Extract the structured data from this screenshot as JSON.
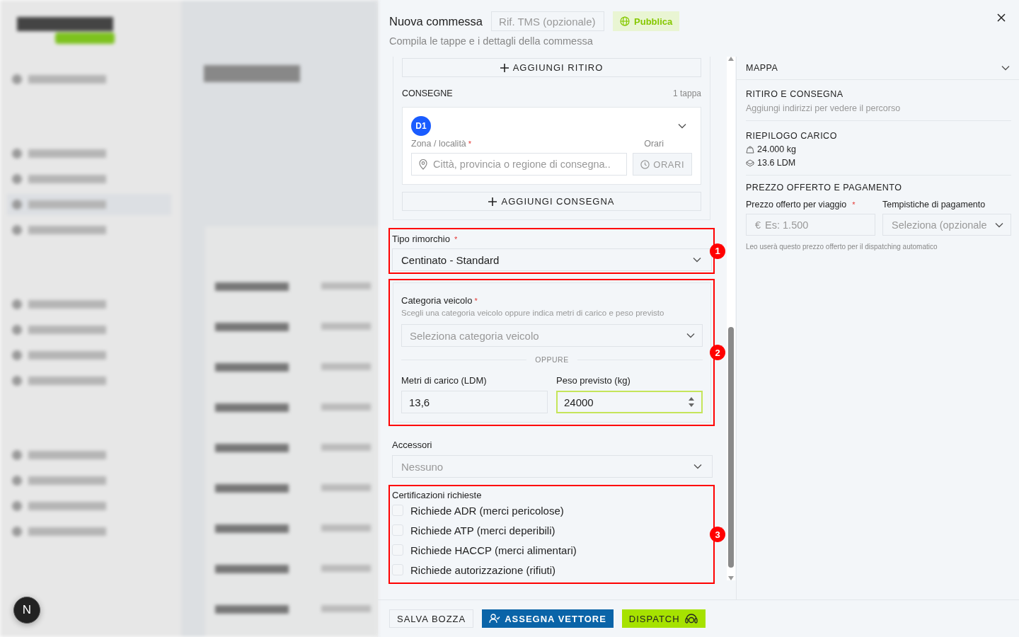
{
  "drawer": {
    "title": "Nuova commessa",
    "tms_field": {
      "placeholder": "Rif. TMS (opzionale)"
    },
    "publish_badge": "Pubblica",
    "subtitle": "Compila le tappe e i dettagli della commessa"
  },
  "stops": {
    "add_pickup": "AGGIUNGI RITIRO",
    "deliveries_title": "CONSEGNE",
    "deliveries_count": "1 tappa",
    "deliveries": [
      {
        "badge": "D1",
        "zone_label": "Zona / località",
        "required_mark": "*",
        "zone_placeholder": "Città, provincia o regione di consegna..",
        "hours_label": "Orari",
        "hours_button": "ORARI"
      }
    ],
    "add_delivery": "AGGIUNGI CONSEGNA"
  },
  "trailer": {
    "label": "Tipo rimorchio",
    "required_mark": "*",
    "value": "Centinato - Standard",
    "annotation": "1"
  },
  "vehicle": {
    "label": "Categoria veicolo",
    "required_mark": "*",
    "hint": "Scegli una categoria veicolo oppure indica metri di carico e peso previsto",
    "placeholder": "Seleziona categoria veicolo",
    "divider": "OPPURE",
    "ldm": {
      "label": "Metri di carico (LDM)",
      "value": "13,6"
    },
    "weight": {
      "label": "Peso previsto (kg)",
      "value": "24000",
      "focused": true
    },
    "annotation": "2"
  },
  "accessories": {
    "label": "Accessori",
    "placeholder": "Nessuno"
  },
  "certifications": {
    "title": "Certificazioni richieste",
    "annotation": "3",
    "options": [
      {
        "label": "Richiede ADR (merci pericolose)",
        "checked": false
      },
      {
        "label": "Richiede ATP (merci deperibili)",
        "checked": false
      },
      {
        "label": "Richiede HACCP (merci alimentari)",
        "checked": false
      },
      {
        "label": "Richiede autorizzazione (rifiuti)",
        "checked": false
      }
    ]
  },
  "summary": {
    "map_title": "MAPPA",
    "route": {
      "title": "RITIRO E CONSEGNA",
      "hint": "Aggiungi indirizzi per vedere il percorso"
    },
    "load": {
      "title": "RIEPILOGO CARICO",
      "weight": "24.000 kg",
      "ldm": "13.6 LDM"
    },
    "price": {
      "title": "PREZZO OFFERTO E PAGAMENTO",
      "price_label": "Prezzo offerto per viaggio",
      "required_mark": "*",
      "currency": "€",
      "price_placeholder": "Es: 1.500",
      "terms_label": "Tempistiche di pagamento",
      "terms_placeholder": "Seleziona (opzionale",
      "note": "Leo userà questo prezzo offerto per il dispatching automatico"
    }
  },
  "footer": {
    "buttons": [
      {
        "label": "SALVA BOZZA",
        "kind": "outline"
      },
      {
        "label": "ASSEGNA VETTORE",
        "kind": "primary"
      },
      {
        "label": "DISPATCH",
        "kind": "accent"
      }
    ]
  },
  "dev_badge": "N"
}
